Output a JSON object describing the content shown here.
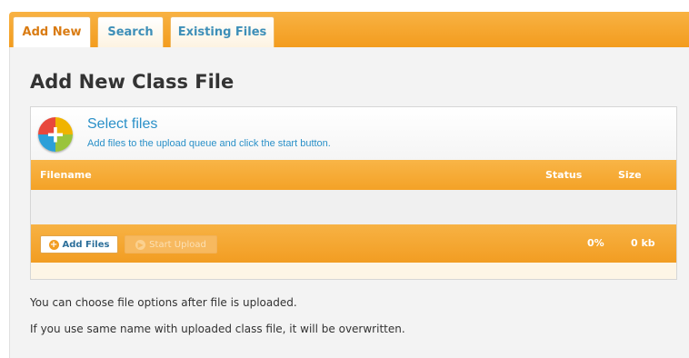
{
  "tabs": [
    {
      "label": "Add New",
      "active": true
    },
    {
      "label": "Search",
      "active": false
    },
    {
      "label": "Existing Files",
      "active": false
    }
  ],
  "page_title": "Add New Class File",
  "uploader": {
    "title": "Select files",
    "subtitle": "Add files to the upload queue and click the start button.",
    "columns": {
      "filename": "Filename",
      "status": "Status",
      "size": "Size"
    },
    "add_button": "Add Files",
    "start_button": "Start Upload",
    "progress": "0%",
    "total_size": "0 kb"
  },
  "info": [
    "You can choose file options after file is uploaded.",
    "If you use same name with uploaded class file, it will be overwritten."
  ],
  "colors": {
    "accent_orange": "#f39c1e",
    "link_blue": "#2a90c8",
    "tab_active": "#d97b12"
  },
  "icons": {
    "select_files": "plus-circle-icon",
    "add_files": "plus-icon",
    "start_upload": "arrow-right-icon"
  }
}
